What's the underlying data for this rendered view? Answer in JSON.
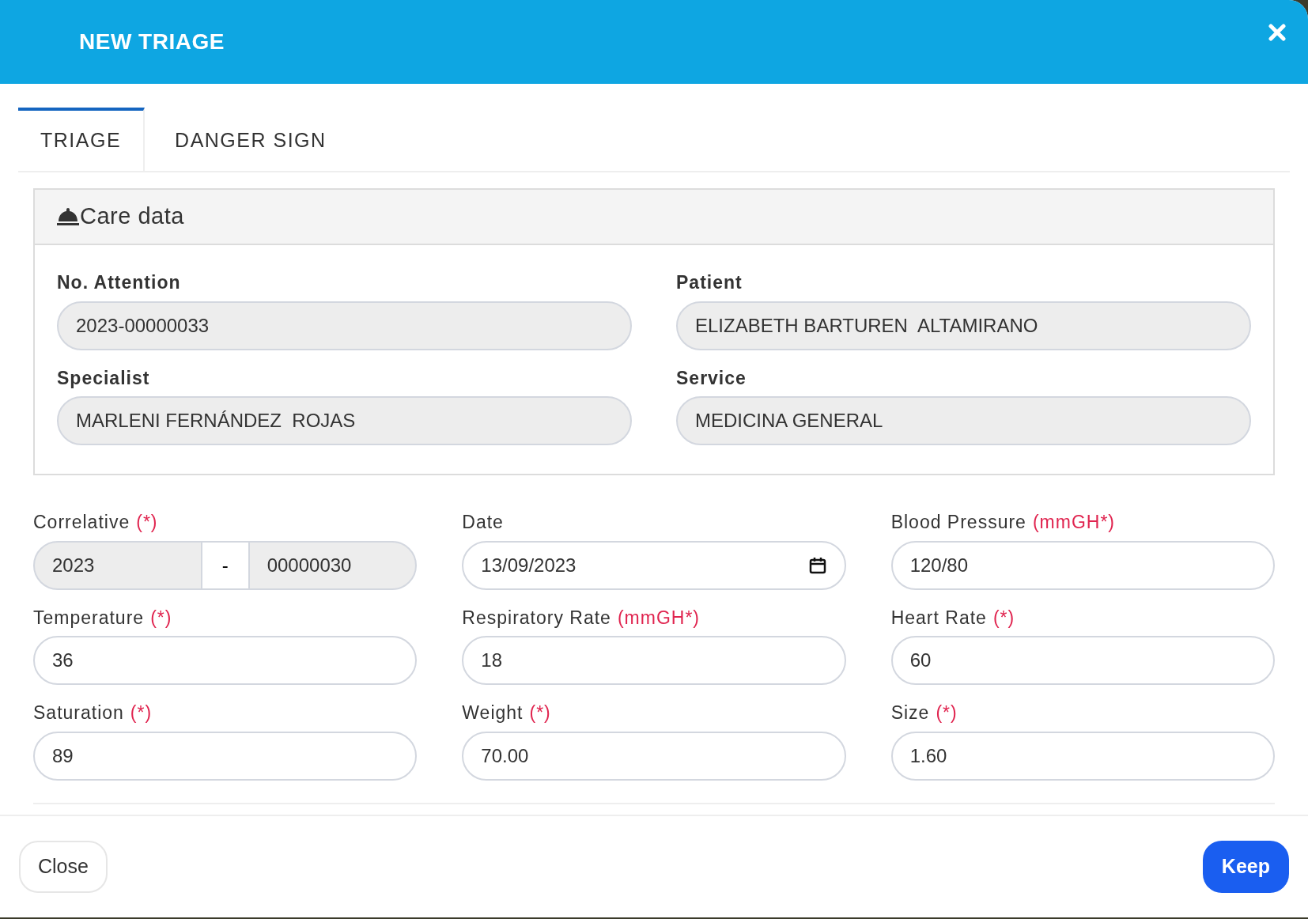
{
  "dialog": {
    "title": "NEW TRIAGE"
  },
  "tabs": [
    {
      "label": "TRIAGE",
      "selected": true
    },
    {
      "label": "DANGER SIGN",
      "selected": false
    }
  ],
  "care_data": {
    "title": "Care data",
    "fields": [
      {
        "label": "No. Attention",
        "value": "2023-00000033",
        "readonly": true
      },
      {
        "label": "Patient",
        "value": "ELIZABETH BARTUREN  ALTAMIRANO",
        "readonly": true
      },
      {
        "label": "Specialist",
        "value": "MARLENI FERNÁNDEZ  ROJAS",
        "readonly": true
      },
      {
        "label": "Service",
        "value": "MEDICINA GENERAL",
        "readonly": true
      }
    ]
  },
  "vitals": [
    {
      "kind": "correlative",
      "label": "Correlative",
      "note": "(*)",
      "parts": [
        "2023",
        "-",
        "00000030"
      ],
      "readonly": true
    },
    {
      "kind": "date",
      "label": "Date",
      "value": "13/09/2023",
      "readonly": false
    },
    {
      "kind": "text",
      "label": "Blood Pressure",
      "note": "(mmGH*)",
      "value": "120/80",
      "readonly": false
    },
    {
      "kind": "text",
      "label": "Temperature",
      "note": "(*)",
      "value": "36",
      "readonly": false
    },
    {
      "kind": "text",
      "label": "Respiratory Rate",
      "note": "(mmGH*)",
      "value": "18",
      "readonly": false
    },
    {
      "kind": "text",
      "label": "Heart Rate",
      "note": "(*)",
      "value": "60",
      "readonly": false
    },
    {
      "kind": "text",
      "label": "Saturation",
      "note": "(*)",
      "value": "89",
      "readonly": false
    },
    {
      "kind": "text",
      "label": "Weight",
      "note": "(*)",
      "value": "70.00",
      "readonly": false
    },
    {
      "kind": "text",
      "label": "Size",
      "note": "(*)",
      "value": "1.60",
      "readonly": false
    }
  ],
  "buttons": [
    {
      "kind": "secondary",
      "label": "Close"
    },
    {
      "kind": "primary",
      "label": "Keep"
    }
  ]
}
